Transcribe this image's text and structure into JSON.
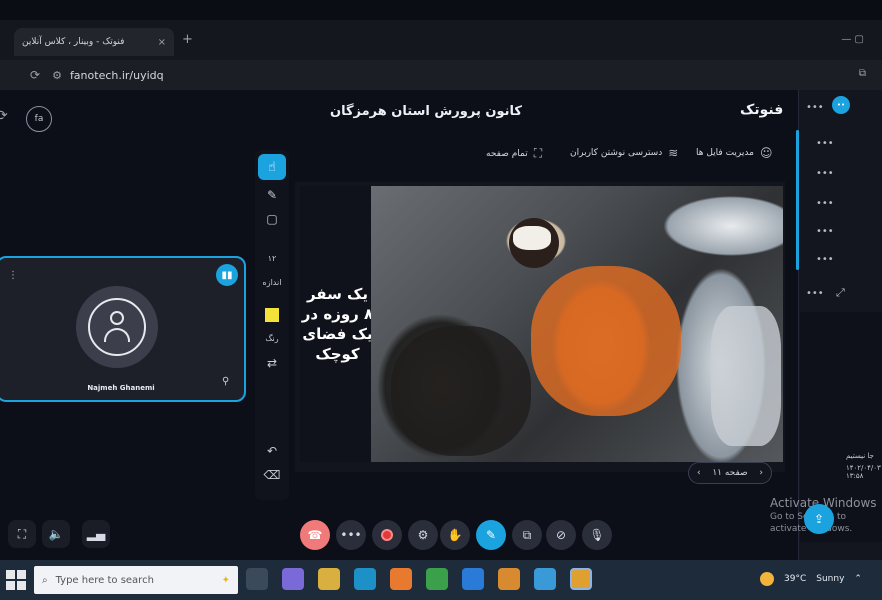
{
  "browser": {
    "tab_title": "فنوتک - وبینار ، کلاس آنلاین",
    "url": "fanotech.ir/uyidq",
    "tab_close": "×",
    "new_tab": "+"
  },
  "header": {
    "room_title": "کانون پرورش استان هرمزگان",
    "brand": "فنوتک",
    "avatar_badge": "fa"
  },
  "actions": {
    "file_manager": "مدیریت فایل ها",
    "user_write_access": "دسترسی نوشتن کاربران",
    "fullscreen": "تمام صفحه"
  },
  "toolbar": {
    "size_value": "۱۲",
    "size_label": "اندازه",
    "color_label": "رنگ",
    "color_value": "#f2e23a"
  },
  "slide": {
    "caption": "یک سفر ۸ روزه در یک فضای کوچک",
    "page_label": "صفحه ۱۱"
  },
  "participant": {
    "name": "Najmeh Ghanemi"
  },
  "chat": {
    "msg_1": "جا نیستیم",
    "msg_2": "۱۴۰۲/۰۴/۰۳ ۱۳:۵۸"
  },
  "watermark": {
    "title": "Activate Windows",
    "subtitle": "Go to Settings to activate Windows."
  },
  "taskbar": {
    "search_placeholder": "Type here to search",
    "weather_temp": "39°C",
    "weather_text": "Sunny"
  }
}
